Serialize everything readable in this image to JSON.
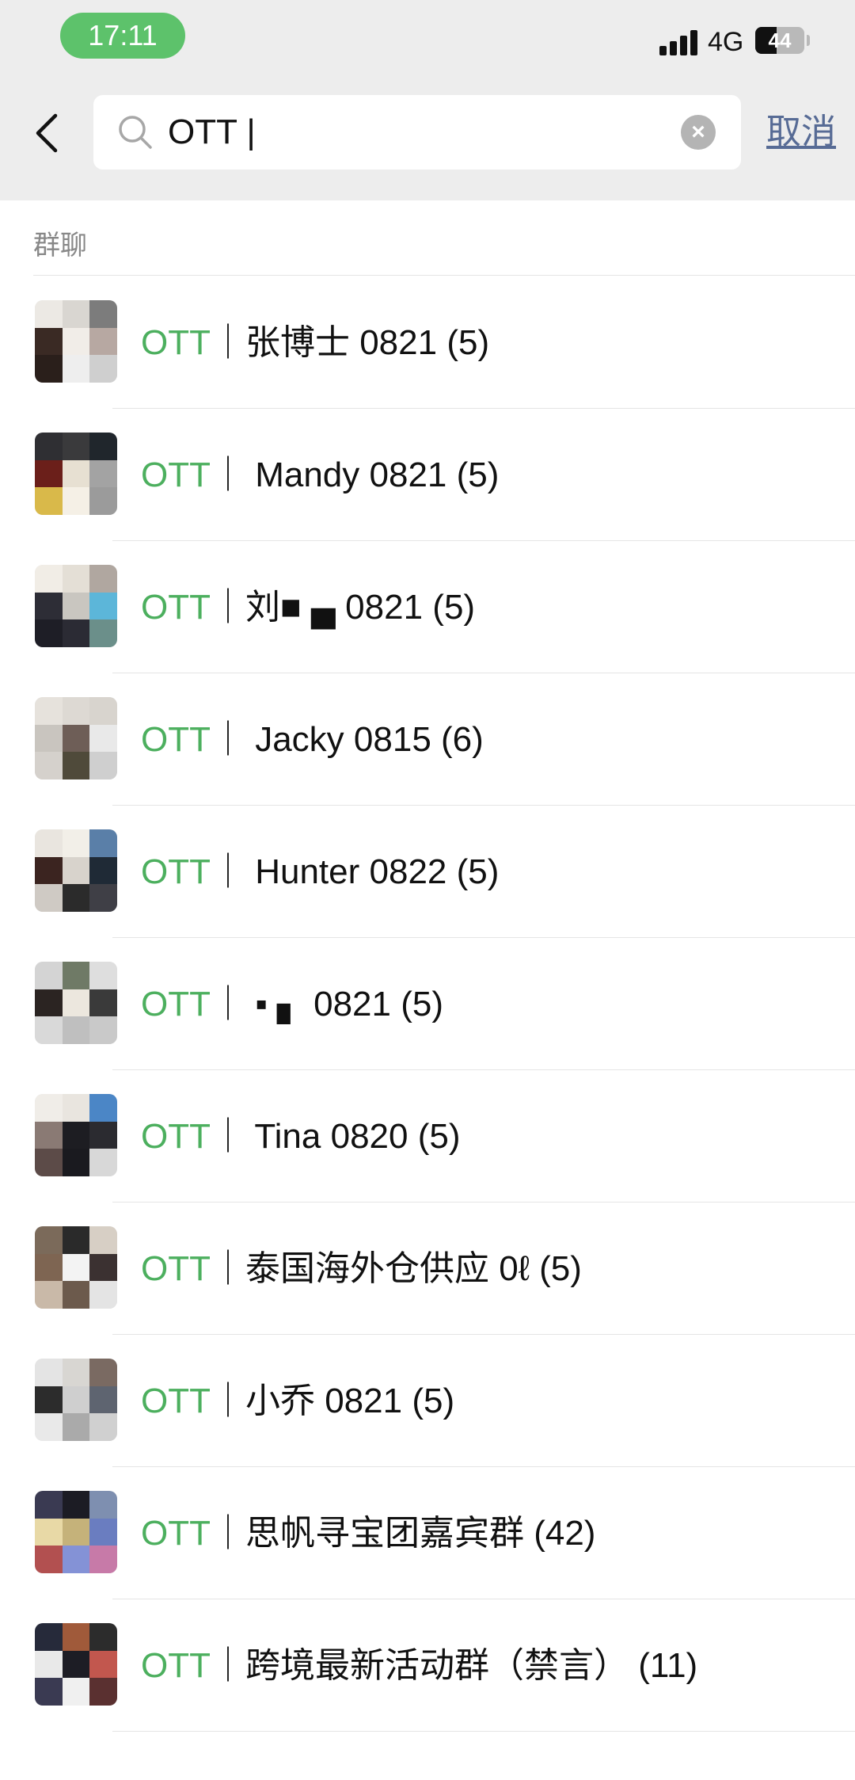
{
  "status_bar": {
    "time": "17:11",
    "network": "4G",
    "battery": "44"
  },
  "search": {
    "query": "OTT |"
  },
  "cancel_label": "取消",
  "section_title": "群聊",
  "highlight": "OTT",
  "results": [
    {
      "rest": "｜张博士 0821 (5)"
    },
    {
      "rest": "｜ Mandy 0821 (5)"
    },
    {
      "rest": "｜刘■ ▄ 0821 (5)"
    },
    {
      "rest": "｜ Jacky 0815 (6)"
    },
    {
      "rest": "｜ Hunter 0822 (5)"
    },
    {
      "rest": "｜ ▪ ▖ 0821 (5)"
    },
    {
      "rest": "｜ Tina 0820 (5)"
    },
    {
      "rest": "｜泰国海外仓供应 0ℓ  (5)"
    },
    {
      "rest": "｜小乔 0821 (5)"
    },
    {
      "rest": "｜思帆寻宝团嘉宾群 (42)"
    },
    {
      "rest": "｜跨境最新活动群（禁言） (11)"
    }
  ],
  "colors": {
    "highlight": "#4caf5e",
    "link": "#576b95",
    "header_bg": "#ededed",
    "time_pill": "#5dc26b"
  }
}
